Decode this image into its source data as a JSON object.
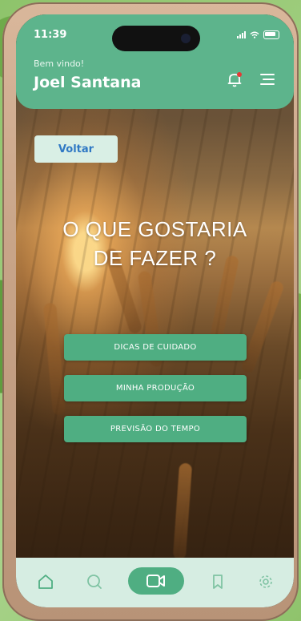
{
  "status_bar": {
    "time": "11:39"
  },
  "header": {
    "greeting": "Bem vindo!",
    "username": "Joel Santana"
  },
  "back_button": {
    "label": "Voltar"
  },
  "main": {
    "question_line1": "O QUE GOSTARIA",
    "question_line2": "DE FAZER ?",
    "actions": [
      {
        "label": "DICAS DE CUIDADO"
      },
      {
        "label": "MINHA PRODUÇÃO"
      },
      {
        "label": "PREVISÃO DO TEMPO"
      }
    ]
  },
  "tab_bar": {
    "items": [
      "home-icon",
      "search-icon",
      "video-camera-icon",
      "bookmark-icon",
      "settings-icon"
    ],
    "active": "video-camera-icon"
  },
  "colors": {
    "accent": "#4fae82",
    "header": "#5db48c",
    "tabbar": "#d6ede2",
    "back_button_text": "#2f78c4",
    "notification_dot": "#e53935"
  }
}
